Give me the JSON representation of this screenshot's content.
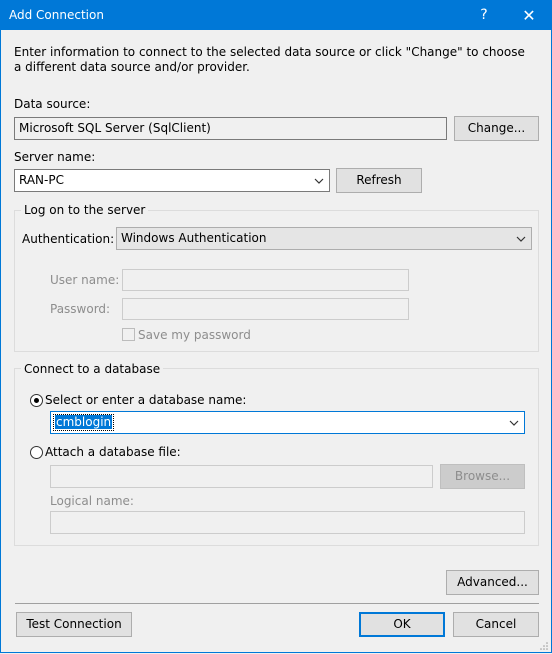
{
  "window": {
    "title": "Add Connection",
    "help_label": "?",
    "close_label": "✕",
    "accent_color": "#0078d7"
  },
  "intro": "Enter information to connect to the selected data source or click \"Change\" to choose a different data source and/or provider.",
  "data_source": {
    "label": "Data source:",
    "value": "Microsoft SQL Server (SqlClient)",
    "change_button": "Change..."
  },
  "server": {
    "label": "Server name:",
    "value": "RAN-PC",
    "refresh_button": "Refresh"
  },
  "logon": {
    "group_title": "Log on to the server",
    "auth_label": "Authentication:",
    "auth_value": "Windows Authentication",
    "username_label": "User name:",
    "username_value": "",
    "password_label": "Password:",
    "password_value": "",
    "save_password_label": "Save my password",
    "save_password_checked": false
  },
  "database": {
    "group_title": "Connect to a database",
    "select_option_label": "Select or enter a database name:",
    "select_option_checked": true,
    "database_value": "cmblogin",
    "attach_option_label": "Attach a database file:",
    "attach_option_checked": false,
    "attach_value": "",
    "browse_button": "Browse...",
    "logical_name_label": "Logical name:",
    "logical_name_value": ""
  },
  "buttons": {
    "advanced": "Advanced...",
    "test_connection": "Test Connection",
    "ok": "OK",
    "cancel": "Cancel"
  }
}
